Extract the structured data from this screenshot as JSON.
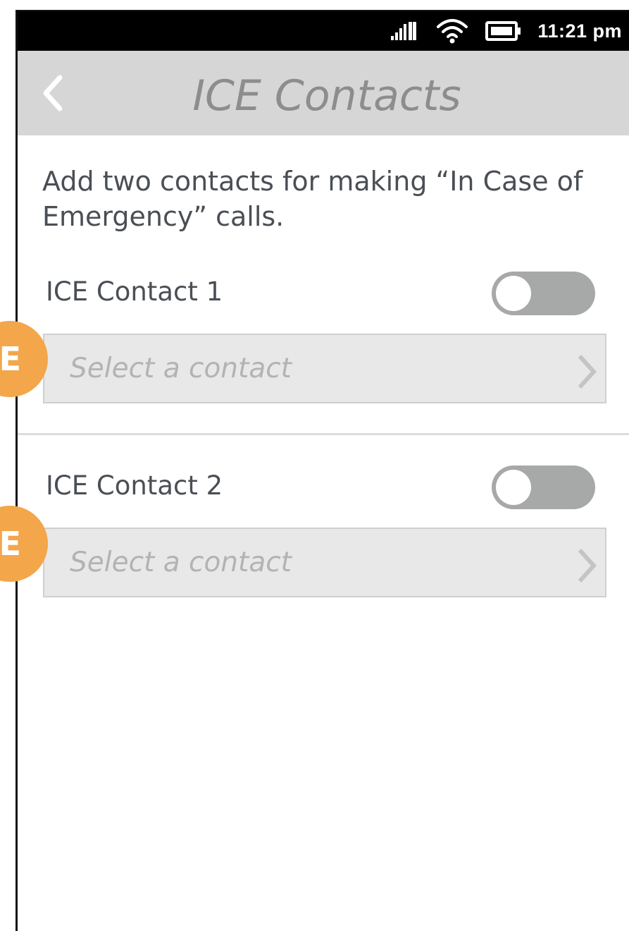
{
  "status_bar": {
    "time": "11:21 pm",
    "icons": [
      "signal-icon",
      "wifi-icon",
      "battery-icon"
    ]
  },
  "header": {
    "title": "ICE Contacts",
    "back_icon": "chevron-left-icon"
  },
  "intro_text": "Add two contacts for making “In Case of Emergency” calls.",
  "contacts": [
    {
      "label": "ICE Contact 1",
      "enabled": false,
      "select_placeholder": "Select a contact",
      "badge": "E"
    },
    {
      "label": "ICE Contact 2",
      "enabled": false,
      "select_placeholder": "Select a contact",
      "badge": "E"
    }
  ],
  "colors": {
    "status_bar": "#000000",
    "header_bg": "#d6d6d6",
    "title": "#8d8d8d",
    "toggle_off": "#a7a9a8",
    "select_bg": "#e8e8e8",
    "badge": "#f3a64a"
  }
}
